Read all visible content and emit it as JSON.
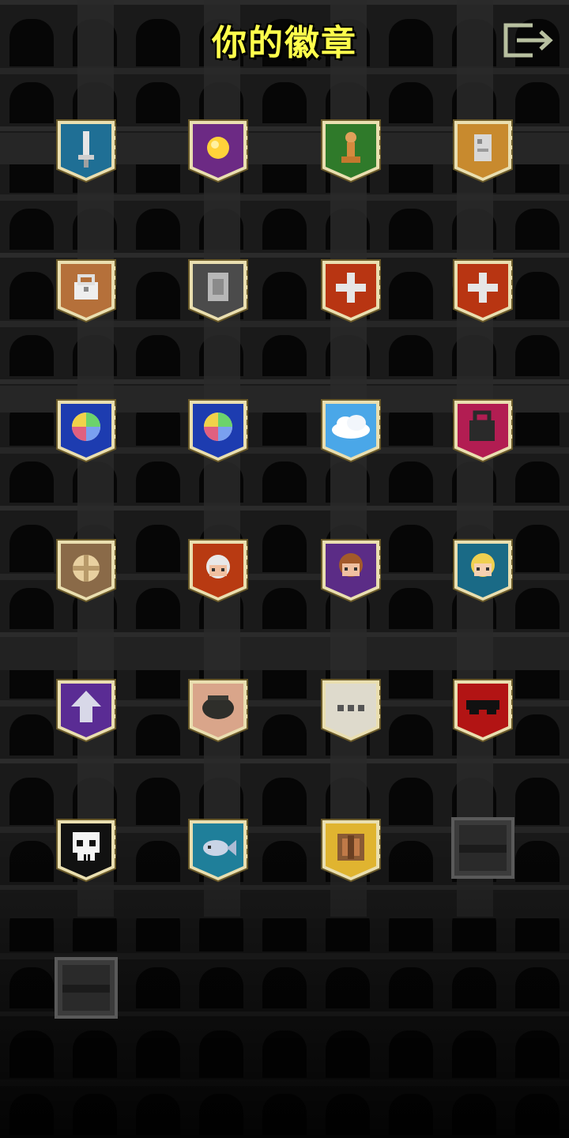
{
  "header": {
    "title": "你的徽章",
    "exit_icon": "exit-door-arrow-icon"
  },
  "badges": [
    {
      "id": "sword-badge",
      "color": "#1f6f95",
      "icon": "sword",
      "unlocked": true
    },
    {
      "id": "gold-badge",
      "color": "#6c2a84",
      "icon": "gold",
      "unlocked": true
    },
    {
      "id": "pawn-badge",
      "color": "#2f7a2a",
      "icon": "pawn",
      "unlocked": true
    },
    {
      "id": "scroll-badge",
      "color": "#c88a2e",
      "icon": "scroll",
      "unlocked": true
    },
    {
      "id": "chest-badge",
      "color": "#b5703a",
      "icon": "chest",
      "unlocked": true
    },
    {
      "id": "item-badge",
      "color": "#4b4b4b",
      "icon": "item",
      "unlocked": true
    },
    {
      "id": "heal-badge-1",
      "color": "#b83512",
      "icon": "plus",
      "unlocked": true
    },
    {
      "id": "heal-badge-2",
      "color": "#b83512",
      "icon": "plus",
      "unlocked": true
    },
    {
      "id": "gem-badge-1",
      "color": "#1d3cb0",
      "icon": "gem",
      "unlocked": true
    },
    {
      "id": "gem-badge-2",
      "color": "#1d3cb0",
      "icon": "gem",
      "unlocked": true
    },
    {
      "id": "cloud-badge",
      "color": "#4aa7e8",
      "icon": "cloud",
      "unlocked": true
    },
    {
      "id": "bag-badge",
      "color": "#b21d52",
      "icon": "bag",
      "unlocked": true
    },
    {
      "id": "food-badge",
      "color": "#8a6a48",
      "icon": "food",
      "unlocked": true
    },
    {
      "id": "warrior-badge",
      "color": "#b83a12",
      "icon": "face-white",
      "unlocked": true
    },
    {
      "id": "rogue-badge",
      "color": "#5b2c86",
      "icon": "face-brown",
      "unlocked": true
    },
    {
      "id": "huntress-badge",
      "color": "#1a6a86",
      "icon": "face-blonde",
      "unlocked": true
    },
    {
      "id": "level-up-badge",
      "color": "#5a2c94",
      "icon": "arrow",
      "unlocked": true
    },
    {
      "id": "pot-badge",
      "color": "#d9a58a",
      "icon": "pot",
      "unlocked": true
    },
    {
      "id": "dots-badge",
      "color": "#dedacc",
      "icon": "dots",
      "unlocked": true
    },
    {
      "id": "mask-badge",
      "color": "#b21414",
      "icon": "mask",
      "unlocked": true
    },
    {
      "id": "skull-badge",
      "color": "#111111",
      "icon": "skull",
      "unlocked": true
    },
    {
      "id": "fish-badge",
      "color": "#1f7f9a",
      "icon": "fish",
      "unlocked": true
    },
    {
      "id": "crate-badge",
      "color": "#e0b430",
      "icon": "crate",
      "unlocked": true
    },
    {
      "id": "locked-badge-1",
      "color": "#2a2a2a",
      "icon": "none",
      "unlocked": false
    },
    {
      "id": "locked-badge-2",
      "color": "#2a2a2a",
      "icon": "none",
      "unlocked": false
    }
  ]
}
